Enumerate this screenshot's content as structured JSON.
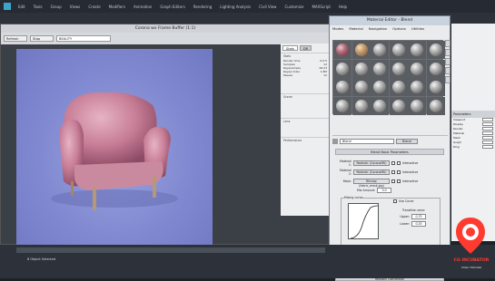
{
  "app": {
    "menus": [
      "Edit",
      "Tools",
      "Group",
      "Views",
      "Create",
      "Modifiers",
      "Animation",
      "Graph Editors",
      "Rendering",
      "Lighting Analysis",
      "Civil View",
      "Customize",
      "MAXScript",
      "Help"
    ]
  },
  "frame_buffer": {
    "title": "Corona wx Frame Buffer (1:1)",
    "toolbar": {
      "refresh_label": "Refresh",
      "stop_label": "Stop",
      "channel_value": "BEAUTY"
    },
    "panel_tabs": [
      "Stats",
      "DR"
    ],
    "sections": [
      "Stats",
      "Scene",
      "Lens",
      "Performance"
    ],
    "stats_rows": [
      [
        "Render time",
        "0:0:5"
      ],
      [
        "Samples",
        "12"
      ],
      [
        "Rays/sample",
        "48.23"
      ],
      [
        "Rays/s total",
        "1.8M"
      ],
      [
        "Passes",
        "12"
      ]
    ],
    "status": "8 Object Selected"
  },
  "material_editor": {
    "title": "Material Editor - Blend",
    "menu": [
      "Modes",
      "Material",
      "Navigation",
      "Options",
      "Utilities"
    ],
    "material_name": "Blend",
    "type_button": "Blend",
    "rollout_title": "Blend Basic Parameters",
    "rows": [
      {
        "label": "Material 1:",
        "button": "Realistic (CoronaMtl)",
        "check_label": "Interactive"
      },
      {
        "label": "Material 2:",
        "button": "Realistic (CoronaMtl)",
        "check_label": "Interactive"
      },
      {
        "label": "Mask:",
        "button": "Bitmap (fabric_mask.jpg)",
        "check_label": "Interactive"
      }
    ],
    "mix_amount_label": "Mix Amount:",
    "mix_amount_value": "0.0",
    "mixing_curve_label": "Mixing curve",
    "use_curve_label": "Use Curve",
    "transition_label": "Transition zone:",
    "upper_label": "Upper:",
    "upper_value": "0.75",
    "lower_label": "Lower:",
    "lower_value": "0.25",
    "bottom_rollout": "Realistic Connection"
  },
  "command_panel": {
    "header": "Parameters",
    "rows": [
      "Viewport",
      "Display",
      "Render",
      "Material",
      "Mesh",
      "Graph",
      "Ring"
    ]
  },
  "brand": {
    "name": "CG INCUBATOR",
    "sub": "Video Tutorials",
    "accent": "#ff3b30"
  }
}
